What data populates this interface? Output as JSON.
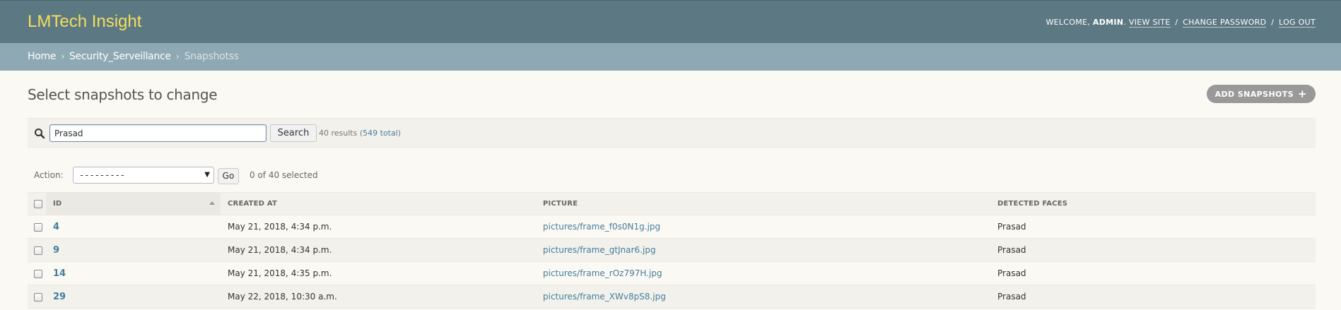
{
  "header": {
    "brand": "LMTech Insight",
    "welcome_prefix": "WELCOME, ",
    "username": "ADMIN",
    "welcome_suffix": ".",
    "view_site": "VIEW SITE",
    "change_password": "CHANGE PASSWORD",
    "log_out": "LOG OUT",
    "separator": "/"
  },
  "breadcrumbs": {
    "home": "Home",
    "app": "Security_Serveillance",
    "current": "Snapshotss",
    "chevron": "›"
  },
  "page": {
    "title": "Select snapshots to change",
    "add_button": "ADD SNAPSHOTS",
    "add_icon": "+"
  },
  "search": {
    "value": "Prasad",
    "button": "Search",
    "results_prefix": "40 results (",
    "total_link": "549 total",
    "results_suffix": ")"
  },
  "actions": {
    "label": "Action:",
    "selected_option": "---------",
    "go": "Go",
    "selected_count": "0 of 40 selected"
  },
  "table": {
    "columns": [
      "ID",
      "CREATED AT",
      "PICTURE",
      "DETECTED FACES"
    ],
    "sorted_column": "ID",
    "rows": [
      {
        "id": "4",
        "created_at": "May 21, 2018, 4:34 p.m.",
        "picture": "pictures/frame_f0s0N1g.jpg",
        "faces": "Prasad"
      },
      {
        "id": "9",
        "created_at": "May 21, 2018, 4:34 p.m.",
        "picture": "pictures/frame_gtJnar6.jpg",
        "faces": "Prasad"
      },
      {
        "id": "14",
        "created_at": "May 21, 2018, 4:35 p.m.",
        "picture": "pictures/frame_rOz797H.jpg",
        "faces": "Prasad"
      },
      {
        "id": "29",
        "created_at": "May 22, 2018, 10:30 a.m.",
        "picture": "pictures/frame_XWv8pS8.jpg",
        "faces": "Prasad"
      }
    ]
  },
  "colors": {
    "header_bg": "#5c7883",
    "brand": "#f5dd5d",
    "breadcrumb_bg": "#8ea9b4",
    "link": "#447e9b",
    "page_bg": "#fbf9f4"
  }
}
